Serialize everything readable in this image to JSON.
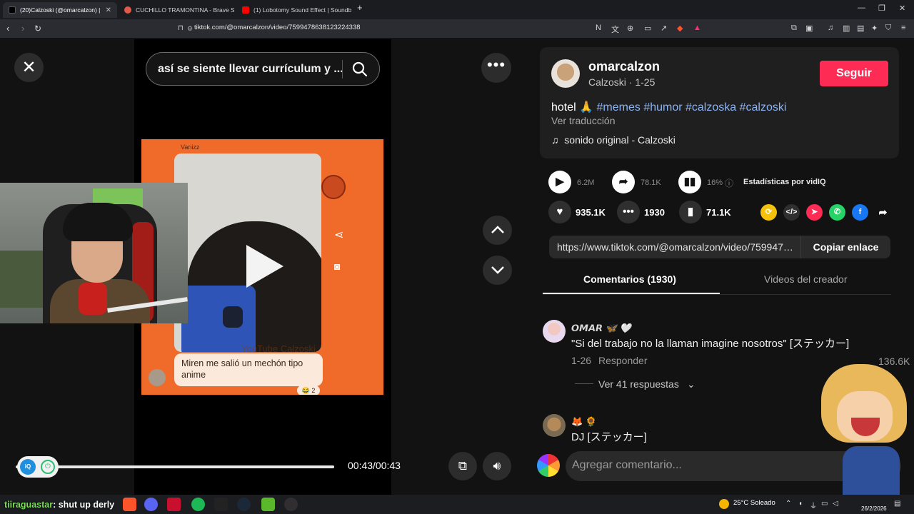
{
  "browser": {
    "tabs": [
      {
        "title": "(20)Calzoski (@omarcalzon) |",
        "active": true
      },
      {
        "title": "CUCHILLO TRAMONTINA - Brave Sea"
      },
      {
        "title": "(1) Lobotomy Sound Effect | Soundb"
      }
    ],
    "new_tab": "+",
    "url": "tiktok.com/@omarcalzon/video/7599478638123224338"
  },
  "video": {
    "search_text": "así se siente llevar currículum y ...",
    "sender_name": "Vanizz",
    "watermark": "YouTube Calzoski",
    "chat_bubble": "Miren me salió un mechón tipo anime",
    "reaction": "😂 2",
    "time": "00:43/00:43",
    "progress": 1.0,
    "overlay_user": "tiiraguastar",
    "overlay_msg": ": shut up derly"
  },
  "panel": {
    "username": "omarcalzon",
    "nickname_date": "Calzoski · 1-25",
    "follow": "Seguir",
    "caption_text": "hotel 🙏 ",
    "hashtags": "#memes #humor #calzoska #calzoski",
    "translate": "Ver traducción",
    "sound": "sonido original - Calzoski",
    "views": "6.2M",
    "shares": "78.1K",
    "stat_pct": "16%",
    "stats_label": "Estadísticas por vidIQ",
    "likes": "935.1K",
    "comments": "1930",
    "saves": "71.1K",
    "link": "https://www.tiktok.com/@omarcalzon/video/7599478638123224338",
    "copy": "Copiar enlace",
    "tab_comments": "Comentarios (1930)",
    "tab_videos": "Videos del creador",
    "add_comment": "Agregar comentario..."
  },
  "comments": [
    {
      "name": "𝙊𝙈𝘼𝙍 🦋 🤍",
      "text": "\"Si del trabajo no la llaman imagine nosotros\" [ステッカー]",
      "date": "1-26",
      "reply": "Responder",
      "likes": "136.6K",
      "replies": "Ver 41 respuestas"
    },
    {
      "name": "🦊 🌻",
      "text": "DJ [ステッカー]"
    }
  ],
  "taskbar": {
    "weather": "25°C  Soleado",
    "date": "26/2/2026"
  },
  "colors": {
    "accent": "#fe2c55",
    "tag": "#8ab4f8",
    "video_bg": "#f06a2a"
  }
}
